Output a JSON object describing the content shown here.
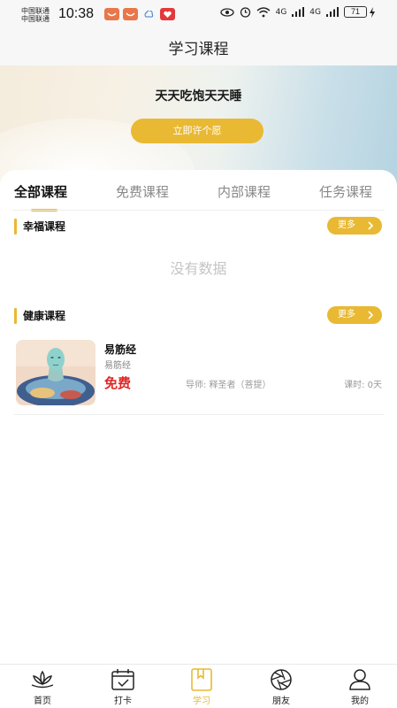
{
  "status_bar": {
    "carrier_1": "中国联通",
    "carrier_2": "中国联通",
    "time": "10:38",
    "network_1": "4G",
    "network_2": "4G",
    "battery": "71"
  },
  "header": {
    "title": "学习课程"
  },
  "banner": {
    "text": "天天吃饱天天睡",
    "wish_button": "立即许个愿"
  },
  "tabs": [
    {
      "label": "全部课程",
      "active": true
    },
    {
      "label": "免费课程",
      "active": false
    },
    {
      "label": "内部课程",
      "active": false
    },
    {
      "label": "任务课程",
      "active": false
    }
  ],
  "sections": [
    {
      "title": "幸福课程",
      "more_label": "更多",
      "empty_text": "没有数据"
    },
    {
      "title": "健康课程",
      "more_label": "更多"
    }
  ],
  "courses": [
    {
      "name": "易筋经",
      "subtitle": "易筋经",
      "price": "免费",
      "teacher": "导师: 释圣者（菩提）",
      "hours": "课时: 0天"
    }
  ],
  "bottom_nav": [
    {
      "label": "首页",
      "icon": "lotus-icon"
    },
    {
      "label": "打卡",
      "icon": "calendar-check-icon"
    },
    {
      "label": "学习",
      "icon": "book-icon",
      "active": true
    },
    {
      "label": "朋友",
      "icon": "aperture-icon"
    },
    {
      "label": "我的",
      "icon": "user-icon"
    }
  ],
  "colors": {
    "accent": "#e9b934",
    "price": "#e02626",
    "muted": "#888888"
  }
}
